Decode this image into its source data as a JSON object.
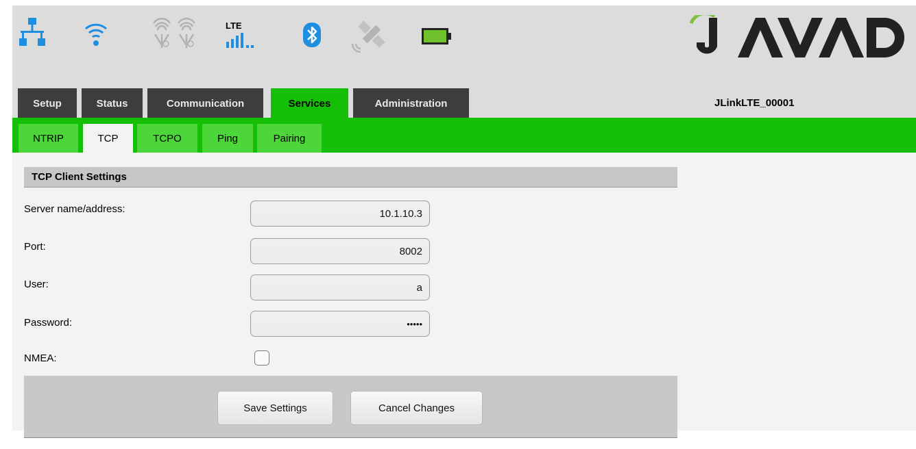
{
  "status_icons": [
    {
      "name": "ethernet-network-icon",
      "color": "#1e8ee0",
      "active": true
    },
    {
      "name": "wifi-icon",
      "color": "#1e8ee0",
      "active": true
    },
    {
      "name": "radio-antenna-icon",
      "color": "#b5b5b5",
      "active": false
    },
    {
      "name": "lte-signal-icon",
      "label": "LTE",
      "color": "#1e8ee0",
      "active": true
    },
    {
      "name": "bluetooth-icon",
      "color": "#1e8ee0",
      "active": true
    },
    {
      "name": "satellite-icon",
      "color": "#b5b5b5",
      "active": false
    },
    {
      "name": "battery-icon",
      "color": "#6fc22b",
      "active": true
    }
  ],
  "brand": {
    "logo_text": "JAVAD",
    "accent": "#7fc241"
  },
  "device_name": "JLinkLTE_00001",
  "top_tabs": [
    {
      "label": "Setup",
      "active": false
    },
    {
      "label": "Status",
      "active": false
    },
    {
      "label": "Communication",
      "active": false
    },
    {
      "label": "Services",
      "active": true
    },
    {
      "label": "Administration",
      "active": false
    }
  ],
  "sub_tabs": [
    {
      "label": "NTRIP",
      "active": false
    },
    {
      "label": "TCP",
      "active": true
    },
    {
      "label": "TCPO",
      "active": false
    },
    {
      "label": "Ping",
      "active": false
    },
    {
      "label": "Pairing",
      "active": false
    }
  ],
  "panel": {
    "title": "TCP Client Settings",
    "fields": [
      {
        "label": "Server name/address:",
        "value": "10.1.10.3"
      },
      {
        "label": "Port:",
        "value": "8002"
      },
      {
        "label": "User:",
        "value": "a"
      },
      {
        "label": "Password:",
        "value": "•••••"
      }
    ],
    "nmea": {
      "label": "NMEA:",
      "checked": false
    }
  },
  "actions": {
    "save_label": "Save Settings",
    "cancel_label": "Cancel Changes"
  },
  "colors": {
    "active_tab": "#14bf05",
    "inactive_tab": "#3d3d3d",
    "sub_tab": "#4cd639"
  }
}
